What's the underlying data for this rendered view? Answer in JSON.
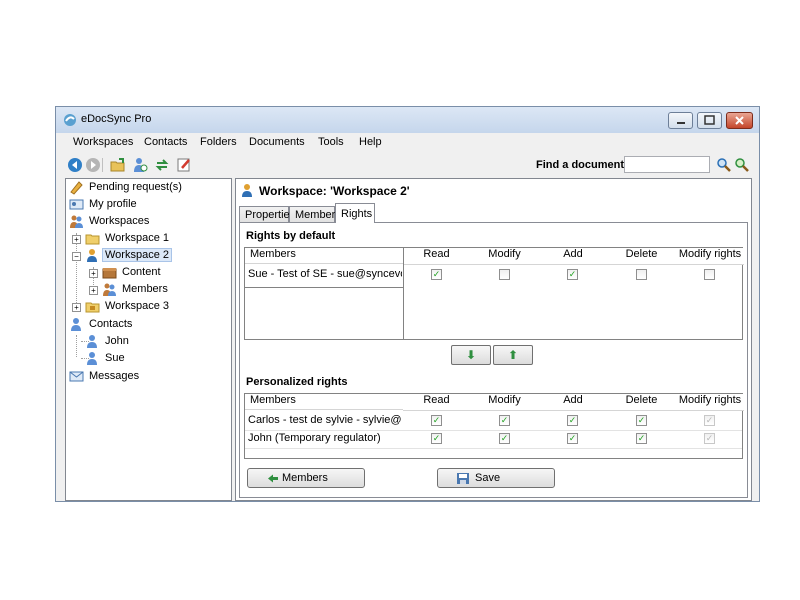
{
  "window": {
    "title": "eDocSync Pro"
  },
  "menu": [
    "Workspaces",
    "Contacts",
    "Folders",
    "Documents",
    "Tools",
    "Help"
  ],
  "toolbar": {
    "find_label": "Find a document",
    "find_value": ""
  },
  "tree": {
    "pending": "Pending request(s)",
    "profile": "My profile",
    "workspaces": "Workspaces",
    "ws1": "Workspace 1",
    "ws2": "Workspace 2",
    "content": "Content",
    "members": "Members",
    "ws3": "Workspace 3",
    "contacts": "Contacts",
    "john": "John",
    "sue": "Sue",
    "messages": "Messages"
  },
  "header": {
    "title": "Workspace: 'Workspace 2'"
  },
  "tabs": [
    "Properties",
    "Members",
    "Rights"
  ],
  "rights_default": {
    "title": "Rights by default",
    "members_header": "Members",
    "columns": [
      "Read",
      "Modify",
      "Add",
      "Delete",
      "Modify rights"
    ],
    "rows": [
      {
        "member": "Sue - Test of SE - sue@syncevoluti...",
        "values": [
          true,
          false,
          true,
          false,
          false
        ],
        "disabled": [
          false,
          false,
          false,
          false,
          false
        ]
      }
    ]
  },
  "personalized": {
    "title": "Personalized rights",
    "members_header": "Members",
    "columns": [
      "Read",
      "Modify",
      "Add",
      "Delete",
      "Modify rights"
    ],
    "rows": [
      {
        "member": "Carlos - test de sylvie - sylvie@korfa...",
        "values": [
          true,
          true,
          true,
          true,
          true
        ],
        "disabled": [
          false,
          false,
          false,
          false,
          true
        ]
      },
      {
        "member": "John (Temporary regulator)",
        "values": [
          true,
          true,
          true,
          true,
          true
        ],
        "disabled": [
          false,
          false,
          false,
          false,
          true
        ]
      }
    ]
  },
  "buttons": {
    "members": "Members",
    "save": "Save"
  },
  "colors": {
    "accent": "#2f8f3f",
    "check": "#21a121",
    "border": "#828790"
  }
}
